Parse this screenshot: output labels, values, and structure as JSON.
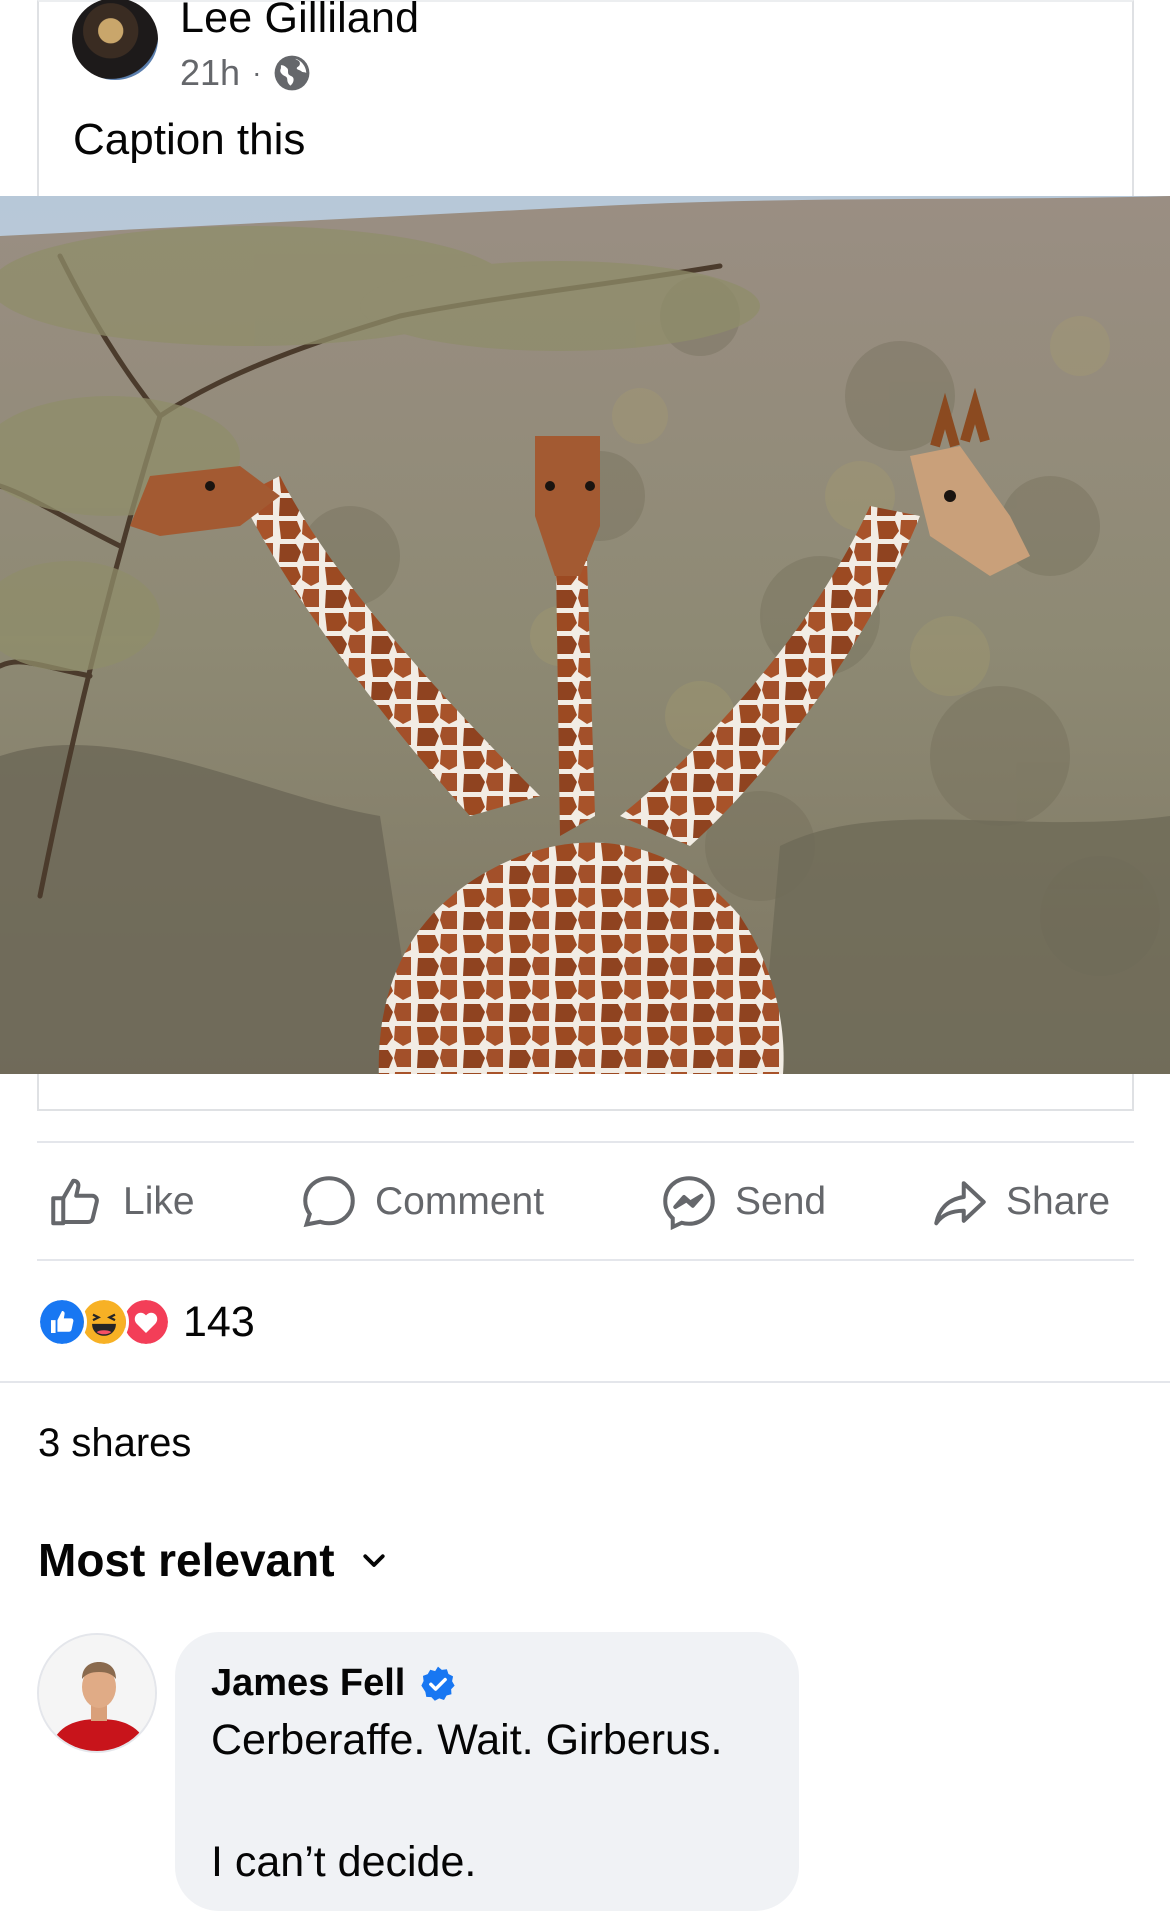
{
  "post": {
    "author": "Lee Gilliland",
    "time": "21h",
    "separator": "·",
    "caption": "Caption this"
  },
  "actions": {
    "like": "Like",
    "comment": "Comment",
    "send": "Send",
    "share": "Share"
  },
  "reactions": {
    "types": [
      "like",
      "haha",
      "love"
    ],
    "count": "143"
  },
  "shares_text": "3 shares",
  "sort_label": "Most relevant",
  "comment": {
    "author": "James Fell",
    "verified": true,
    "line1": "Cerberaffe. Wait. Girberus.",
    "line2": "I can’t decide."
  },
  "colors": {
    "like_blue": "#1877f2",
    "love_red": "#f33e58",
    "haha_yellow": "#f7b125",
    "secondary_text": "#65676b",
    "bubble_bg": "#f0f2f5"
  }
}
